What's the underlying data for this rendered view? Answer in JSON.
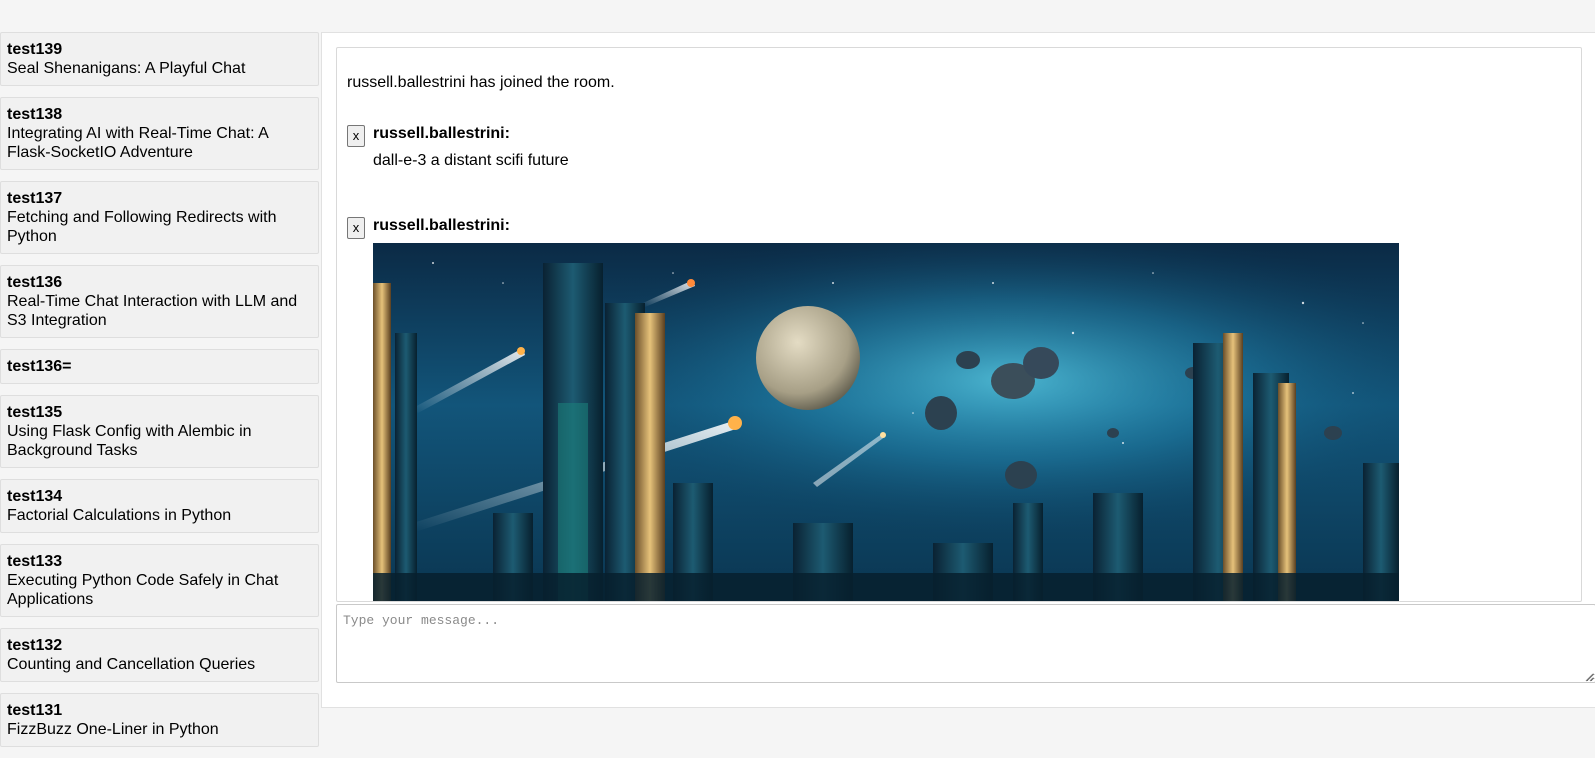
{
  "rooms": [
    {
      "name": "test139",
      "title": "Seal Shenanigans: A Playful Chat"
    },
    {
      "name": "test138",
      "title": "Integrating AI with Real-Time Chat: A Flask-SocketIO Adventure"
    },
    {
      "name": "test137",
      "title": "Fetching and Following Redirects with Python"
    },
    {
      "name": "test136",
      "title": "Real-Time Chat Interaction with LLM and S3 Integration"
    },
    {
      "name": "test136=",
      "title": ""
    },
    {
      "name": "test135",
      "title": "Using Flask Config with Alembic in Background Tasks"
    },
    {
      "name": "test134",
      "title": "Factorial Calculations in Python"
    },
    {
      "name": "test133",
      "title": "Executing Python Code Safely in Chat Applications"
    },
    {
      "name": "test132",
      "title": "Counting and Cancellation Queries"
    },
    {
      "name": "test131",
      "title": "FizzBuzz One-Liner in Python"
    }
  ],
  "chat": {
    "join_message": "russell.ballestrini has joined the room.",
    "messages": [
      {
        "delete_label": "x",
        "user": "russell.ballestrini:",
        "text": "dall-e-3 a distant scifi future"
      },
      {
        "delete_label": "x",
        "user": "russell.ballestrini:",
        "image_alt": "scifi city skyline with planet and asteroids"
      }
    ]
  },
  "composer": {
    "placeholder": "Type your message...",
    "value": ""
  }
}
